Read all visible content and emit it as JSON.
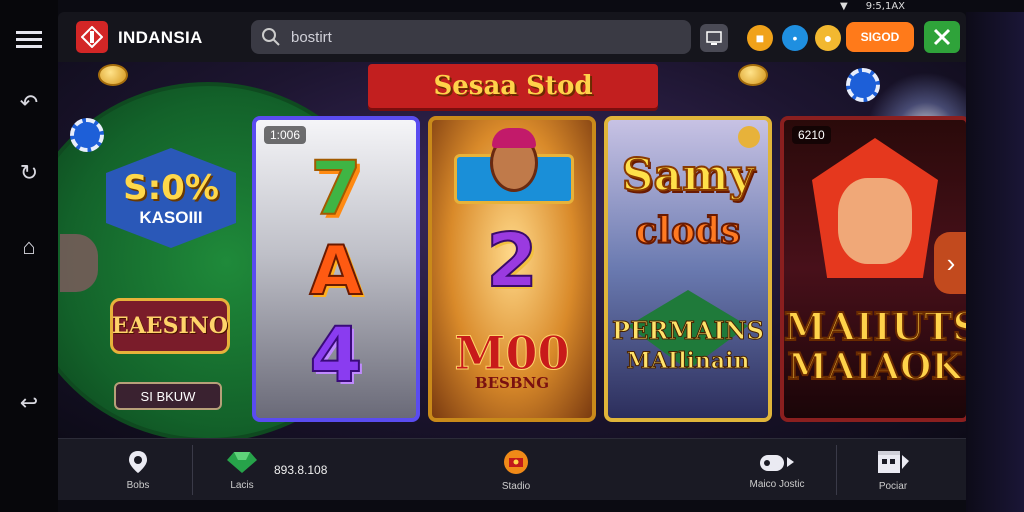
{
  "status_bar": {
    "time_text": "9:5,1AX"
  },
  "header": {
    "brand": "INDANSIA",
    "search_placeholder": "bostirt",
    "signin_label": "SIGOD"
  },
  "banner": {
    "title": "Sesaa Stod"
  },
  "promo": {
    "badge_value": "S:0%",
    "badge_label": "KASOIII",
    "easino_label": "EAESINO",
    "pill_label": "SI BKUW"
  },
  "cards": [
    {
      "tag": "1:006",
      "sym1": "7",
      "sym2": "A",
      "sym3": "4"
    },
    {
      "sym1": "2",
      "mid": "M00",
      "low": "BESBNG"
    },
    {
      "t1": "Samy",
      "t2": "clods",
      "t3": "PERMAINS",
      "t4": "MAIlinain"
    },
    {
      "tag": "6210",
      "t1": "MAIIUTS",
      "t2": "MAIAOK"
    }
  ],
  "bottom": {
    "items": [
      {
        "label": "Bobs",
        "icon": "location-pin-icon"
      },
      {
        "label": "Lacis",
        "icon": "emerald-icon"
      },
      {
        "label": "Stadio",
        "icon": "casino-chest-icon"
      },
      {
        "label": "Maico Jostic",
        "icon": "gamepad-icon"
      },
      {
        "label": "Pociar",
        "icon": "store-icon"
      }
    ],
    "balance": "893.8.108"
  }
}
